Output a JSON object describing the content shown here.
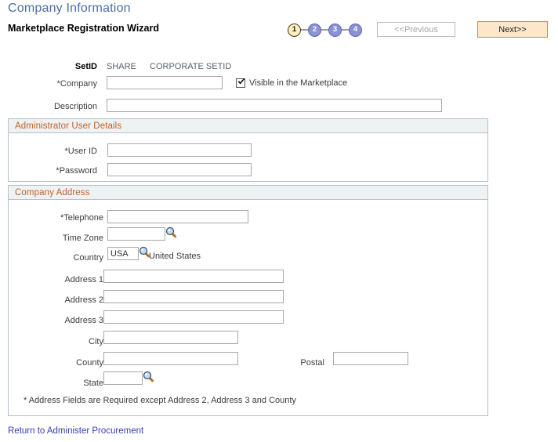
{
  "header": {
    "page_title": "Company Information",
    "subtitle": "Marketplace Registration Wizard"
  },
  "wizard": {
    "steps": [
      {
        "number": "1",
        "state": "current"
      },
      {
        "number": "2",
        "state": "pending"
      },
      {
        "number": "3",
        "state": "pending"
      },
      {
        "number": "4",
        "state": "pending"
      }
    ],
    "previous_label": "<<Previous",
    "next_label": "Next>>",
    "previous_disabled": true
  },
  "form": {
    "setid_label": "SetID",
    "setid_value": "SHARE",
    "setid_description": "CORPORATE SETID",
    "company_label": "*Company",
    "company_value": "",
    "company_placeholder": "",
    "visible_checkbox_label": "Visible in the Marketplace",
    "visible_checked": true,
    "description_label": "Description",
    "description_value": "",
    "description_placeholder": ""
  },
  "admin_section": {
    "title": "Administrator User Details",
    "user_id_label": "*User ID",
    "user_id_value": "",
    "password_label": "*Password",
    "password_value": ""
  },
  "address_section": {
    "title": "Company Address",
    "telephone_label": "*Telephone",
    "telephone_value": "",
    "timezone_label": "Time Zone",
    "timezone_value": "",
    "country_label": "Country",
    "country_value": "USA",
    "country_description": "United States",
    "address1_label": "Address 1",
    "address1_value": "",
    "address2_label": "Address 2",
    "address2_value": "",
    "address3_label": "Address 3",
    "address3_value": "",
    "city_label": "City",
    "city_value": "",
    "county_label": "County",
    "county_value": "",
    "postal_label": "Postal",
    "postal_value": "",
    "state_label": "State",
    "state_value": "",
    "note": "* Address Fields are Required except Address 2, Address 3 and County"
  },
  "footer": {
    "return_link": "Return to Administer Procurement"
  },
  "icons": {
    "lookup": "magnifier-lookup-icon",
    "checkbox_tick": "checkmark-icon"
  },
  "colors": {
    "title_blue": "#4a6fa5",
    "section_orange": "#c0622a",
    "next_button_bg": "#fce7cb",
    "next_button_border": "#d98a2b",
    "step_current_bg": "#fbeec0",
    "step_pending_bg": "#8b93d4",
    "link_blue": "#3b3bb5",
    "panel_header_bg": "#eef2f3",
    "panel_border": "#b3bfc9"
  }
}
